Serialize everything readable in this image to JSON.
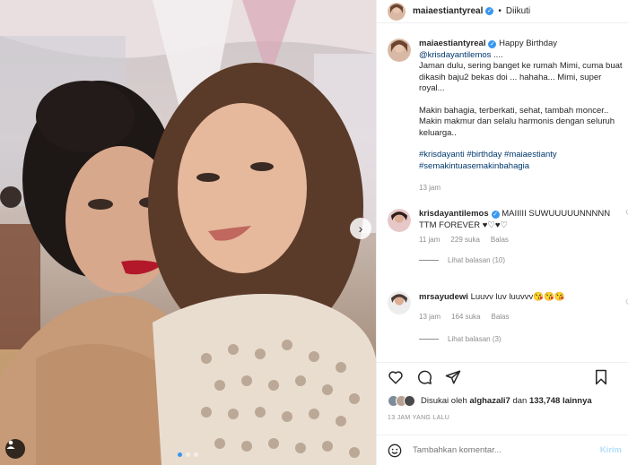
{
  "header": {
    "username": "maiaestiantyreal",
    "separator": "•",
    "follow_status": "Diikuti"
  },
  "caption": {
    "username": "maiaestiantyreal",
    "line1_text": "Happy Birthday",
    "mention": "@krisdayantilemos",
    "line1_tail": "....",
    "para1": "Jaman dulu, sering banget ke rumah Mimi, cuma buat dikasih baju2 bekas doi ... hahaha... Mimi, super royal...",
    "para2": "Makin bahagia, terberkati, sehat, tambah moncer.. Makin makmur dan selalu harmonis dengan seluruh keluarga..",
    "hashtags": "#krisdayanti #birthday #maiaestianty #semakintuasemakinbahagia",
    "time": "13 jam"
  },
  "comments": [
    {
      "username": "krisdayantilemos",
      "text": "MAIIIII SUWUUUUUNNNNN TTM FOREVER ♥♡♥♡",
      "time": "11 jam",
      "likes": "229 suka",
      "reply": "Balas",
      "view_replies": "Lihat balasan (10)"
    },
    {
      "username": "mrsayudewi",
      "text": "Luuvv luv luuvvv😘😘😘",
      "time": "13 jam",
      "likes": "164 suka",
      "reply": "Balas",
      "view_replies": "Lihat balasan (3)"
    }
  ],
  "likes": {
    "prefix": "Disukai oleh",
    "user": "alghazali7",
    "connector": "dan",
    "count": "133,748",
    "suffix": "lainnya"
  },
  "posted_time": "13 JAM YANG LALU",
  "add_comment": {
    "placeholder": "Tambahkan komentar...",
    "post_label": "Kirim"
  },
  "icons": {
    "verified": "verified-badge-icon",
    "heart": "heart-icon",
    "comment": "comment-icon",
    "share": "share-icon",
    "save": "bookmark-icon",
    "emoji": "emoji-icon",
    "next": "chevron-right-icon",
    "tag": "user-tag-icon"
  },
  "colors": {
    "verified": "#3897f0",
    "link": "#00376b",
    "muted": "#8e8e8e",
    "post_button": "#b2dffc"
  }
}
